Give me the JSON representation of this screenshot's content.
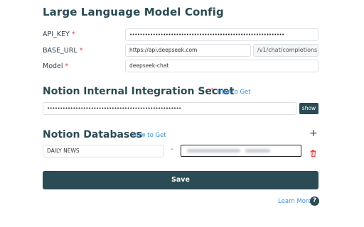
{
  "llm": {
    "title": "Large Language Model Config",
    "api_key_label": "API_KEY",
    "api_key_value": "••••••••••••••••••••••••••••••••••••••••••••••••••••••••••••",
    "base_url_label": "BASE_URL",
    "base_url_value": "https://api.deepseek.com",
    "base_url_suffix": "/v1/chat/completions",
    "model_label": "Model",
    "model_value": "deepseek-chat",
    "required_marker": "*"
  },
  "notion_secret": {
    "title": "Notion Internal Integration Secret",
    "required_marker": "*",
    "how_to": "How to Get",
    "value": "••••••••••••••••••••••••••••••••••••••••••••••••••••",
    "show_label": "show"
  },
  "notion_db": {
    "title": "Notion Databases",
    "how_to": "How to Get",
    "add_icon": "+",
    "rows": [
      {
        "name": "DAILY NEWS",
        "separator": "-"
      }
    ]
  },
  "actions": {
    "save_label": "Save",
    "learn_more": "Learn More",
    "help_glyph": "?"
  },
  "colors": {
    "primary": "#2b4b55",
    "link": "#3a8fd9",
    "required": "#e04848"
  }
}
